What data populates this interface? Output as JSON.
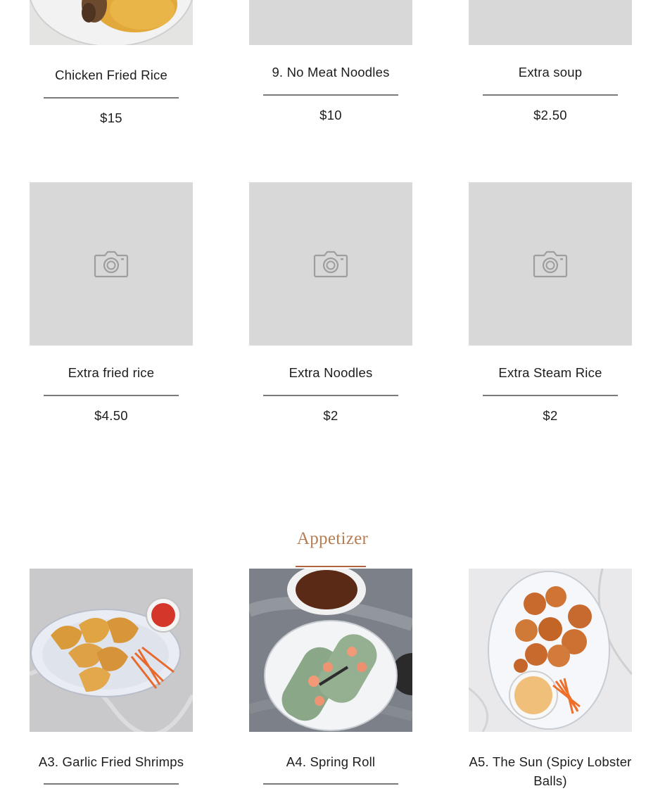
{
  "section": {
    "title": "Appetizer",
    "accent_color": "#b67c52"
  },
  "items_row1": [
    {
      "name": "Chicken Fried Rice",
      "price": "$15",
      "image": "fried-rice-photo"
    },
    {
      "name": "9. No Meat Noodles",
      "price": "$10",
      "image": "placeholder"
    },
    {
      "name": "Extra soup",
      "price": "$2.50",
      "image": "placeholder"
    }
  ],
  "items_row2": [
    {
      "name": "Extra fried rice",
      "price": "$4.50",
      "image": "placeholder"
    },
    {
      "name": "Extra Noodles",
      "price": "$2",
      "image": "placeholder"
    },
    {
      "name": "Extra Steam Rice",
      "price": "$2",
      "image": "placeholder"
    }
  ],
  "items_row3": [
    {
      "name": "A3. Garlic Fried Shrimps",
      "image": "fried-shrimp-photo"
    },
    {
      "name": "A4. Spring Roll",
      "image": "spring-roll-photo"
    },
    {
      "name": "A5. The Sun (Spicy Lobster Balls)",
      "image": "lobster-balls-photo"
    }
  ],
  "icons": {
    "placeholder": "camera-icon"
  }
}
